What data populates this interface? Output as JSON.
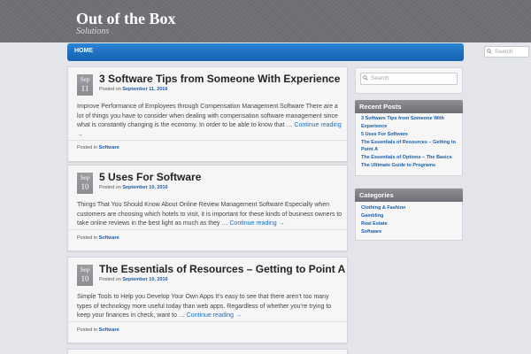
{
  "site": {
    "title": "Out of the Box",
    "description": "Solutions"
  },
  "nav": {
    "home_label": "HOME",
    "search_placeholder": "Search"
  },
  "sidebar_search": {
    "placeholder": "Search"
  },
  "posts": [
    {
      "month": "Sep",
      "day": "11",
      "title": "3 Software Tips from Someone With Experience",
      "meta_prefix": "Posted on",
      "date": "September 11, 2016",
      "excerpt": "Improve Performance of Employees through Compensation Management Software There are a lot of things you have to consider when dealing with compensation software management since what is constantly changing is the economy. In order to be able to know that …",
      "more": "Continue reading →",
      "cat_prefix": "Posted in",
      "category": "Software"
    },
    {
      "month": "Sep",
      "day": "10",
      "title": "5 Uses For Software",
      "meta_prefix": "Posted on",
      "date": "September 10, 2016",
      "excerpt": "Things That You Should Know About Online Review Management Software Especially when customers are choosing which hotels to visit, it is important for these kinds of business owners to take online reviews in the best light as much as they …",
      "more": "Continue reading →",
      "cat_prefix": "Posted in",
      "category": "Software"
    },
    {
      "month": "Sep",
      "day": "10",
      "title": "The Essentials of Resources – Getting to Point A",
      "meta_prefix": "Posted on",
      "date": "September 10, 2016",
      "excerpt": "Simple Tools to Help you Develop Your Own Apps It’s easy to see that there aren’t too many types of technology more useful today than web apps. Regardless of whether you’re trying to keep your finances in check, want to …",
      "more": "Continue reading →",
      "cat_prefix": "Posted in",
      "category": "Software"
    }
  ],
  "recent_posts": {
    "title": "Recent Posts",
    "items": [
      "3 Software Tips from Someone With Experience",
      "5 Uses For Software",
      "The Essentials of Resources – Getting to Point A",
      "The Essentials of Options – The Basics",
      "The Ultimate Guide to Programs"
    ]
  },
  "categories": {
    "title": "Categories",
    "items": [
      "Clothing & Fashion",
      "Gambling",
      "Real Estate",
      "Software"
    ]
  }
}
